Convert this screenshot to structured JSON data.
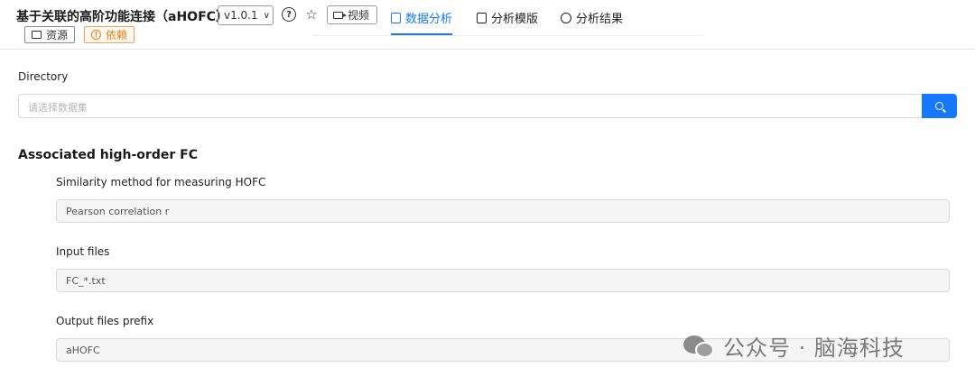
{
  "header": {
    "title": "基于关联的高阶功能连接（aHOFC）",
    "version": "v1.0.1",
    "video_label": "视频",
    "tags": {
      "resources": "资源",
      "dependencies": "依赖"
    }
  },
  "tabs": [
    {
      "label": "数据分析",
      "active": true
    },
    {
      "label": "分析模版",
      "active": false
    },
    {
      "label": "分析结果",
      "active": false
    }
  ],
  "directory": {
    "label": "Directory",
    "placeholder": "请选择数据集"
  },
  "section": {
    "title": "Associated high-order FC",
    "fields": [
      {
        "label": "Similarity method for measuring HOFC",
        "value": "Pearson correlation r"
      },
      {
        "label": "Input files",
        "value": "FC_*.txt"
      },
      {
        "label": "Output files prefix",
        "value": "aHOFC"
      }
    ]
  },
  "watermark": "公众号 · 脑海科技",
  "colors": {
    "accent": "#1677ff",
    "warning": "#e9801c"
  }
}
